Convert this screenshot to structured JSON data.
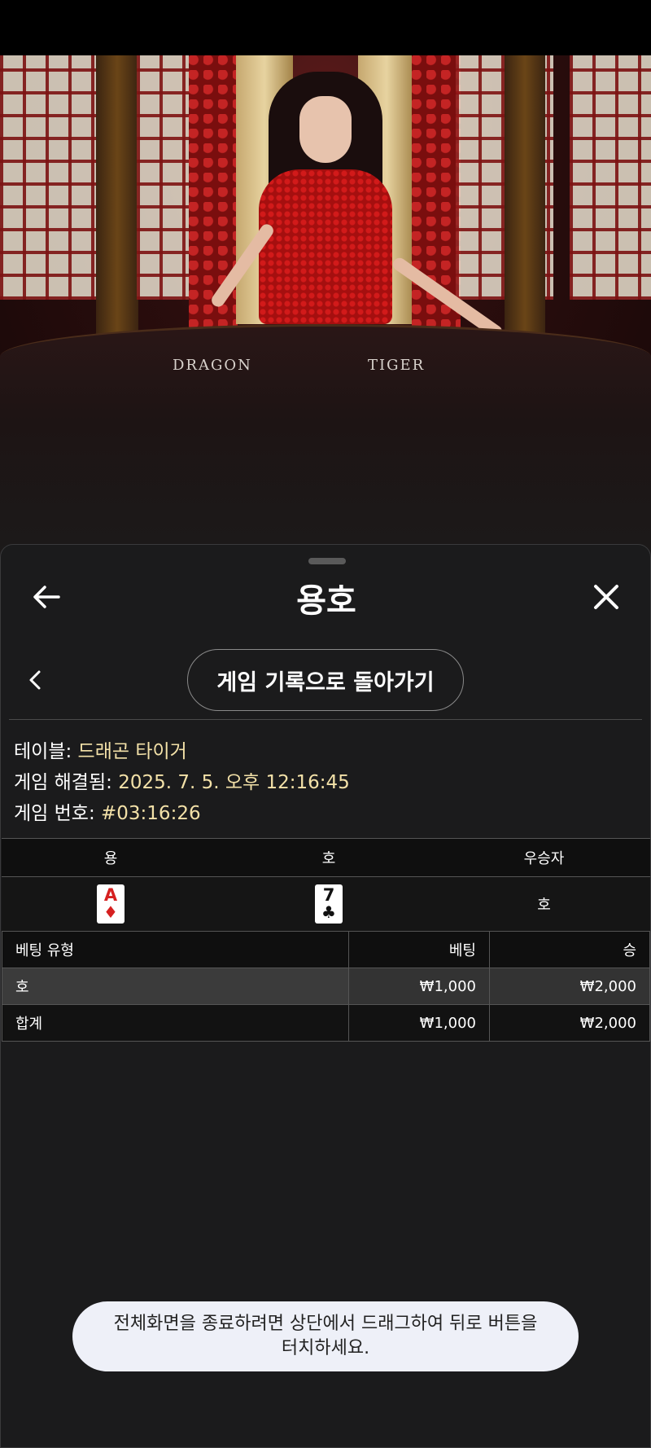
{
  "video": {
    "table_left_label": "DRAGON",
    "table_right_label": "TIGER"
  },
  "header": {
    "title": "용호",
    "back_icon": "arrow-left-icon",
    "close_icon": "close-icon"
  },
  "nav": {
    "prev_icon": "chevron-left-icon",
    "back_to_history_label": "게임 기록으로 돌아가기"
  },
  "info": {
    "table_key": "테이블:",
    "table_value": "드래곤 타이거",
    "resolved_key": "게임 해결됨:",
    "resolved_value": "2025. 7. 5. 오후 12:16:45",
    "number_key": "게임 번호:",
    "number_value": "#03:16:26"
  },
  "result": {
    "headers": [
      "용",
      "호",
      "우승자"
    ],
    "dragon_card": {
      "rank": "A",
      "suit": "♦",
      "color": "#d62020"
    },
    "tiger_card": {
      "rank": "7",
      "suit": "♣",
      "color": "#111111"
    },
    "winner": "호"
  },
  "bets": {
    "headers": [
      "베팅 유형",
      "베팅",
      "승"
    ],
    "rows": [
      {
        "type": "호",
        "bet": "₩1,000",
        "win": "₩2,000"
      },
      {
        "type": "합계",
        "bet": "₩1,000",
        "win": "₩2,000"
      }
    ]
  },
  "toast": {
    "line1": "전체화면을 종료하려면 상단에서 드래그하여 뒤로 버튼을",
    "line2": "터치하세요."
  }
}
